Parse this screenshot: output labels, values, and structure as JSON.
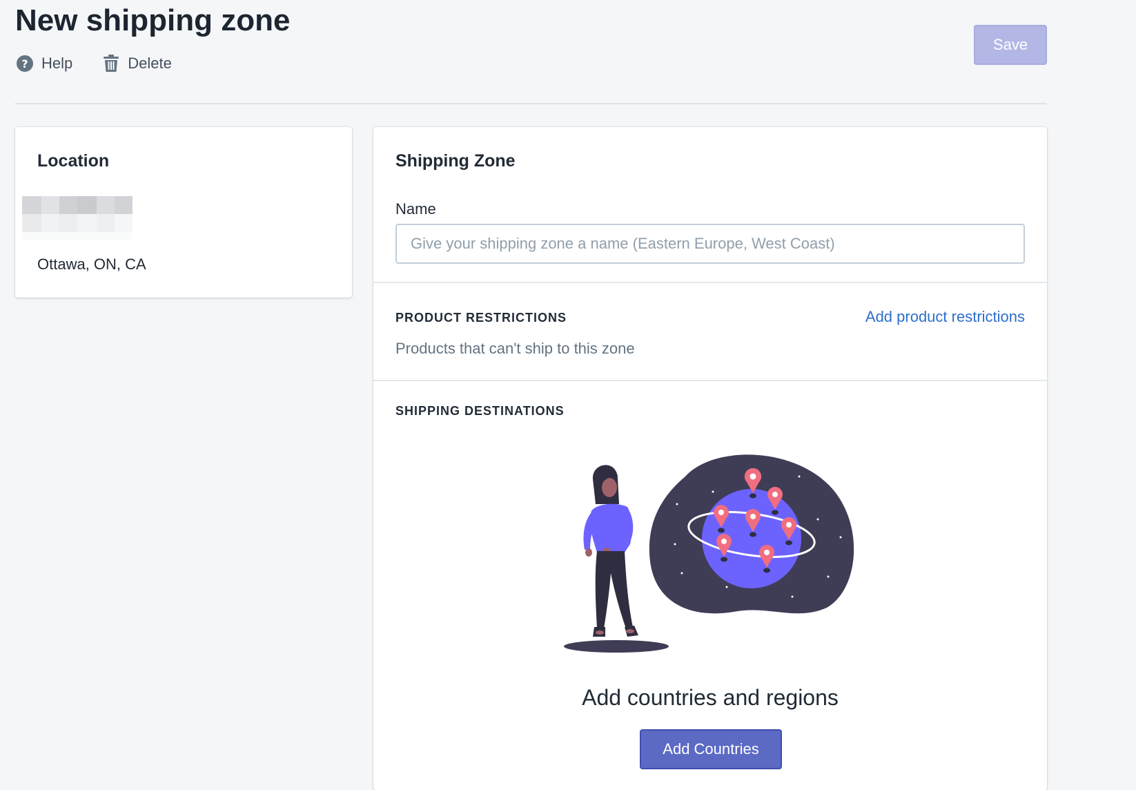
{
  "header": {
    "title": "New shipping zone",
    "actions": [
      {
        "label": "Help",
        "icon": "help-icon"
      },
      {
        "label": "Delete",
        "icon": "trash-icon"
      }
    ],
    "save_label": "Save"
  },
  "location": {
    "title": "Location",
    "city": "Ottawa, ON, CA"
  },
  "zone": {
    "title": "Shipping Zone",
    "name_label": "Name",
    "name_placeholder": "Give your shipping zone a name (Eastern Europe, West Coast)",
    "name_value": "",
    "restrictions": {
      "heading": "PRODUCT RESTRICTIONS",
      "link": "Add product restrictions",
      "description": "Products that can't ship to this zone"
    },
    "destinations": {
      "heading": "SHIPPING DESTINATIONS",
      "empty_title": "Add countries and regions",
      "button": "Add Countries"
    }
  },
  "colors": {
    "accent": "#5c6ac4",
    "accent_disabled": "#b3b7e6",
    "link": "#2c6ecb",
    "background": "#f4f6f8",
    "illustration_dark": "#3f3d56",
    "illustration_primary": "#6c63ff",
    "pin": "#f06e80"
  }
}
